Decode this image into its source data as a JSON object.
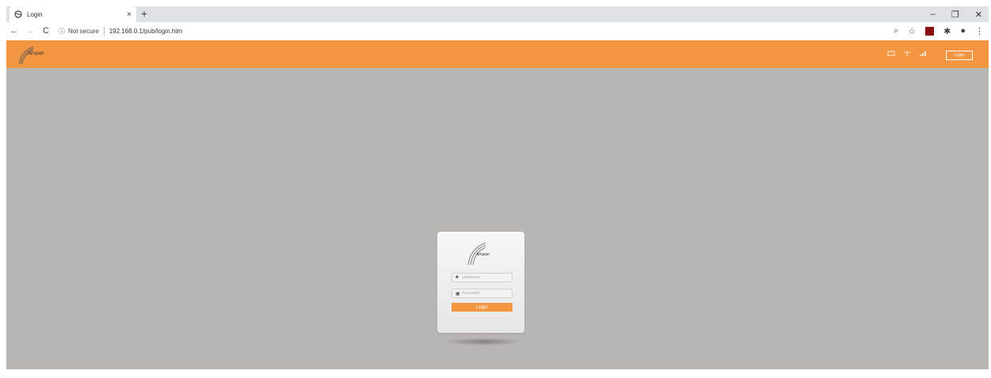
{
  "browser": {
    "tab": {
      "title": "Login",
      "close_glyph": "×"
    },
    "new_tab_glyph": "+",
    "window_controls": {
      "minimize": "–",
      "restore": "❐",
      "close": "✕"
    },
    "nav": {
      "back": "←",
      "forward": "→",
      "reload": "C"
    },
    "security": {
      "icon_glyph": "ⓘ",
      "label": "Not secure"
    },
    "url": "192.168.0.1/pub/login.htm",
    "toolbar_icons": {
      "zoom": "⌕",
      "star": "☆",
      "extensions": "✱",
      "profile": "●",
      "menu": "⋮"
    }
  },
  "header": {
    "brand": "Airspan",
    "login_label": "Login"
  },
  "login": {
    "brand": "Airspan",
    "username_placeholder": "Username",
    "password_placeholder": "Password",
    "submit_label": "Login"
  },
  "colors": {
    "accent": "#f39642",
    "page_background": "#b9b5b3"
  }
}
